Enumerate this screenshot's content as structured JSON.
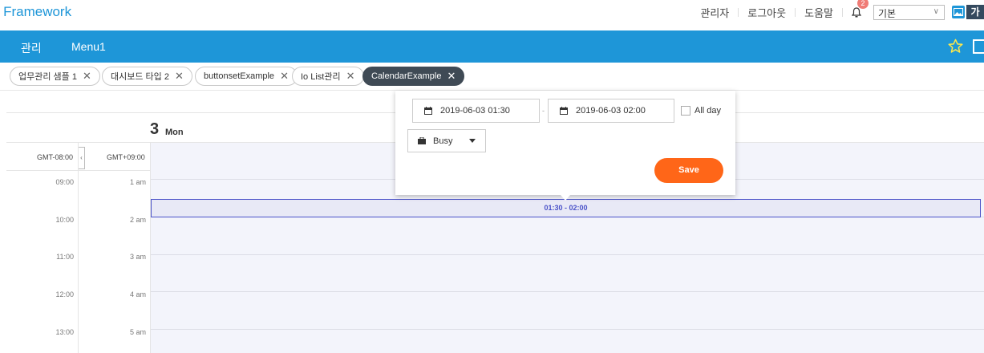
{
  "app": {
    "title": "Framework"
  },
  "topnav": {
    "admin": "관리자",
    "logout": "로그아웃",
    "help": "도움말",
    "notification_count": "2",
    "theme_value": "기본",
    "lang_label": "가"
  },
  "menu": {
    "items": [
      "관리",
      "Menu1"
    ]
  },
  "tabs": [
    "업무관리 샘플 1",
    "대시보드 타입 2",
    "buttonsetExample",
    "Io List관리",
    "CalendarExample"
  ],
  "calendar": {
    "day_number": "3",
    "day_name": "Mon",
    "tz_left": "GMT-08:00",
    "tz_right": "GMT+09:00",
    "tz_toggle": "‹",
    "rows": [
      {
        "left": "09:00",
        "right": "1 am"
      },
      {
        "left": "10:00",
        "right": "2 am"
      },
      {
        "left": "11:00",
        "right": "3 am"
      },
      {
        "left": "12:00",
        "right": "4 am"
      },
      {
        "left": "13:00",
        "right": "5 am"
      }
    ],
    "event_label": "01:30 - 02:00"
  },
  "popup": {
    "start": "2019-06-03 01:30",
    "end": "2019-06-03 02:00",
    "separator": "-",
    "allday_label": "All day",
    "state": "Busy",
    "save_label": "Save"
  },
  "colors": {
    "accent": "#1e96d8",
    "save": "#ff6618",
    "event": "#4a52c8",
    "active_tab": "#3f4a55"
  }
}
